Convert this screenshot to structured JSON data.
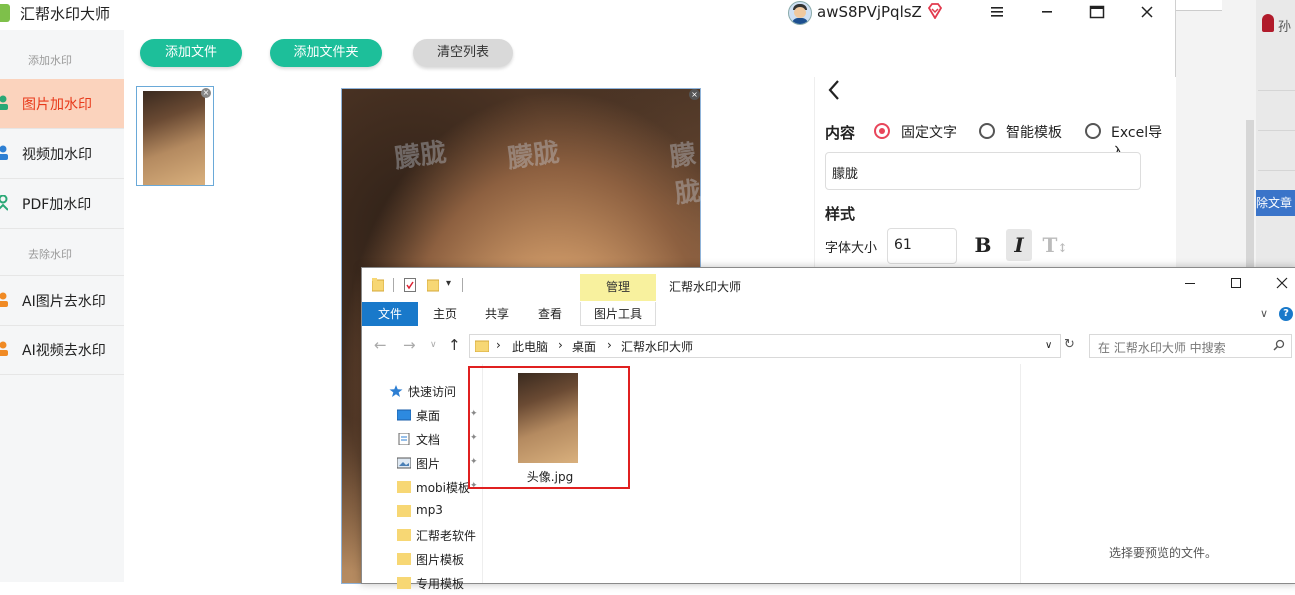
{
  "app": {
    "title": "汇帮水印大师",
    "username": "awS8PVjPqlsZ",
    "window_controls": [
      "menu-icon",
      "minimize-icon",
      "maximize-icon",
      "close-icon"
    ]
  },
  "sidebar": {
    "section_add": "添加水印",
    "section_remove": "去除水印",
    "items": [
      {
        "label": "图片加水印",
        "active": true,
        "icon_color": "#2aa876"
      },
      {
        "label": "视频加水印",
        "active": false,
        "icon_color": "#2d7fd3"
      },
      {
        "label": "PDF加水印",
        "active": false,
        "icon_color": "#2aa876"
      },
      {
        "label": "AI图片去水印",
        "active": false,
        "icon_color": "#f08a24"
      },
      {
        "label": "AI视频去水印",
        "active": false,
        "icon_color": "#f08a24"
      }
    ]
  },
  "toolbar": {
    "add_file": "添加文件",
    "add_folder": "添加文件夹",
    "clear_list": "清空列表"
  },
  "preview": {
    "watermark_text": "朦胧"
  },
  "settings": {
    "back_icon": "chevron-left-icon",
    "content_label": "内容",
    "options": [
      "固定文字",
      "智能模板",
      "Excel导入"
    ],
    "selected_option": "固定文字",
    "text_value": "朦胧",
    "style_label": "样式",
    "font_size_label": "字体大小",
    "font_size_value": "61",
    "bold_label": "B",
    "italic_label": "I",
    "text_height_label": "T"
  },
  "explorer": {
    "manage_tab": "管理",
    "window_title": "汇帮水印大师",
    "ribbon_tabs": [
      "文件",
      "主页",
      "共享",
      "查看"
    ],
    "picture_tools_tab": "图片工具",
    "breadcrumb": [
      "此电脑",
      "桌面",
      "汇帮水印大师"
    ],
    "search_placeholder": "在 汇帮水印大师 中搜索",
    "nav": [
      {
        "label": "快速访问",
        "icon": "star-icon"
      },
      {
        "label": "桌面",
        "icon": "desktop-icon",
        "pinned": true
      },
      {
        "label": "文档",
        "icon": "document-icon",
        "pinned": true
      },
      {
        "label": "图片",
        "icon": "pictures-icon",
        "pinned": true
      },
      {
        "label": "mobi模板",
        "icon": "folder-icon",
        "pinned": true
      },
      {
        "label": "mp3",
        "icon": "folder-icon"
      },
      {
        "label": "汇帮老软件",
        "icon": "folder-icon"
      },
      {
        "label": "图片模板",
        "icon": "folder-icon"
      },
      {
        "label": "专用模板",
        "icon": "folder-icon"
      }
    ],
    "file_name": "头像.jpg",
    "preview_hint": "选择要预览的文件。"
  },
  "background_window": {
    "text_fragment": "孙",
    "blue_chip": "除文章"
  }
}
